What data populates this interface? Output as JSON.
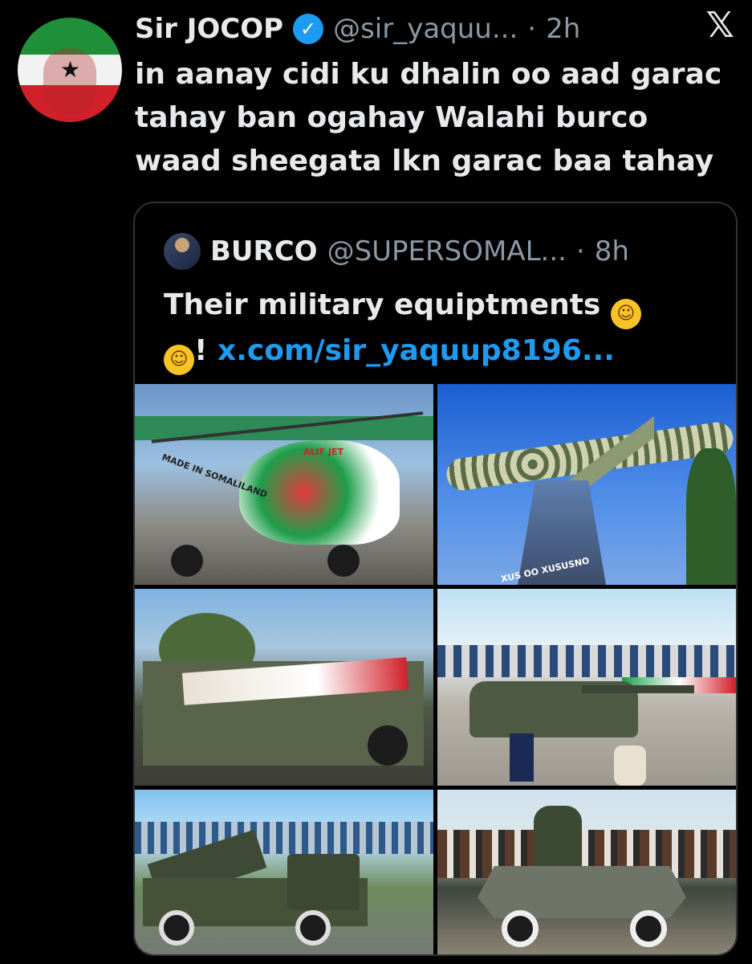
{
  "author": {
    "name": "Sir JOCOP",
    "handle": "@sir_yaquu...",
    "separator": "·",
    "time": "2h"
  },
  "tweet": {
    "text_line1": "in aanay cidi ku dhalin oo aad  garac",
    "text_line2": "tahay ban ogahay Walahi burco",
    "text_line3": "waad sheegata lkn garac baa tahay"
  },
  "quoted": {
    "name": "BURCO",
    "handle": "@SUPERSOMAL...",
    "separator": "·",
    "time": "8h",
    "text_part1": "Their military equiptments",
    "text_part2": "!",
    "link": "x.com/sir_yaquup8196..."
  },
  "images": {
    "helicopter_banner": "MADE IN SOMALILAND",
    "helicopter_tail": "ALIF JET",
    "monument_text": "XUS OO XUSUSNO"
  },
  "icons": {
    "verified": "verified-badge-icon",
    "platform": "x-logo-icon",
    "emoji": "rolling-on-floor-laughing-emoji"
  },
  "colors": {
    "background": "#000000",
    "text": "#e7e9ea",
    "muted": "#8b98a5",
    "link": "#1d9bf0",
    "border": "#2f3336"
  }
}
